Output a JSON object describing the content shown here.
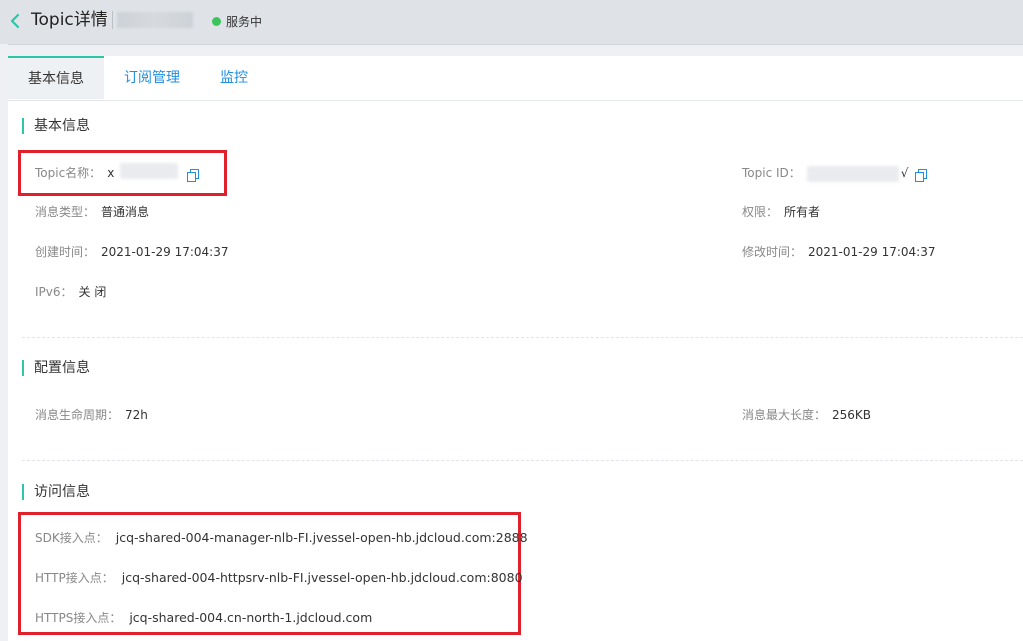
{
  "header": {
    "title": "Topic详情",
    "status": "服务中"
  },
  "tabs": [
    {
      "label": "基本信息",
      "active": true
    },
    {
      "label": "订阅管理",
      "active": false
    },
    {
      "label": "监控",
      "active": false
    }
  ],
  "basic": {
    "section_title": "基本信息",
    "topic_name_label": "Topic名称：",
    "topic_name_value": "x",
    "topic_id_label": "Topic ID：",
    "topic_id_value": "√",
    "msg_type_label": "消息类型：",
    "msg_type_value": "普通消息",
    "permission_label": "权限：",
    "permission_value": "所有者",
    "created_label": "创建时间：",
    "created_value": "2021-01-29 17:04:37",
    "modified_label": "修改时间：",
    "modified_value": "2021-01-29 17:04:37",
    "ipv6_label": "IPv6：",
    "ipv6_value": "关 闭"
  },
  "config": {
    "section_title": "配置信息",
    "lifecycle_label": "消息生命周期：",
    "lifecycle_value": "72h",
    "max_len_label": "消息最大长度：",
    "max_len_value": "256KB"
  },
  "access": {
    "section_title": "访问信息",
    "sdk_label": "SDK接入点：",
    "sdk_value": "jcq-shared-004-manager-nlb-FI.jvessel-open-hb.jdcloud.com:2888",
    "http_label": "HTTP接入点：",
    "http_value": "jcq-shared-004-httpsrv-nlb-FI.jvessel-open-hb.jdcloud.com:8080",
    "https_label": "HTTPS接入点：",
    "https_value": "jcq-shared-004.cn-north-1.jdcloud.com"
  },
  "colors": {
    "accent": "#2ec6a8",
    "link": "#1f8fe0",
    "status_dot": "#3cc35c",
    "highlight_box": "#e0202b"
  }
}
